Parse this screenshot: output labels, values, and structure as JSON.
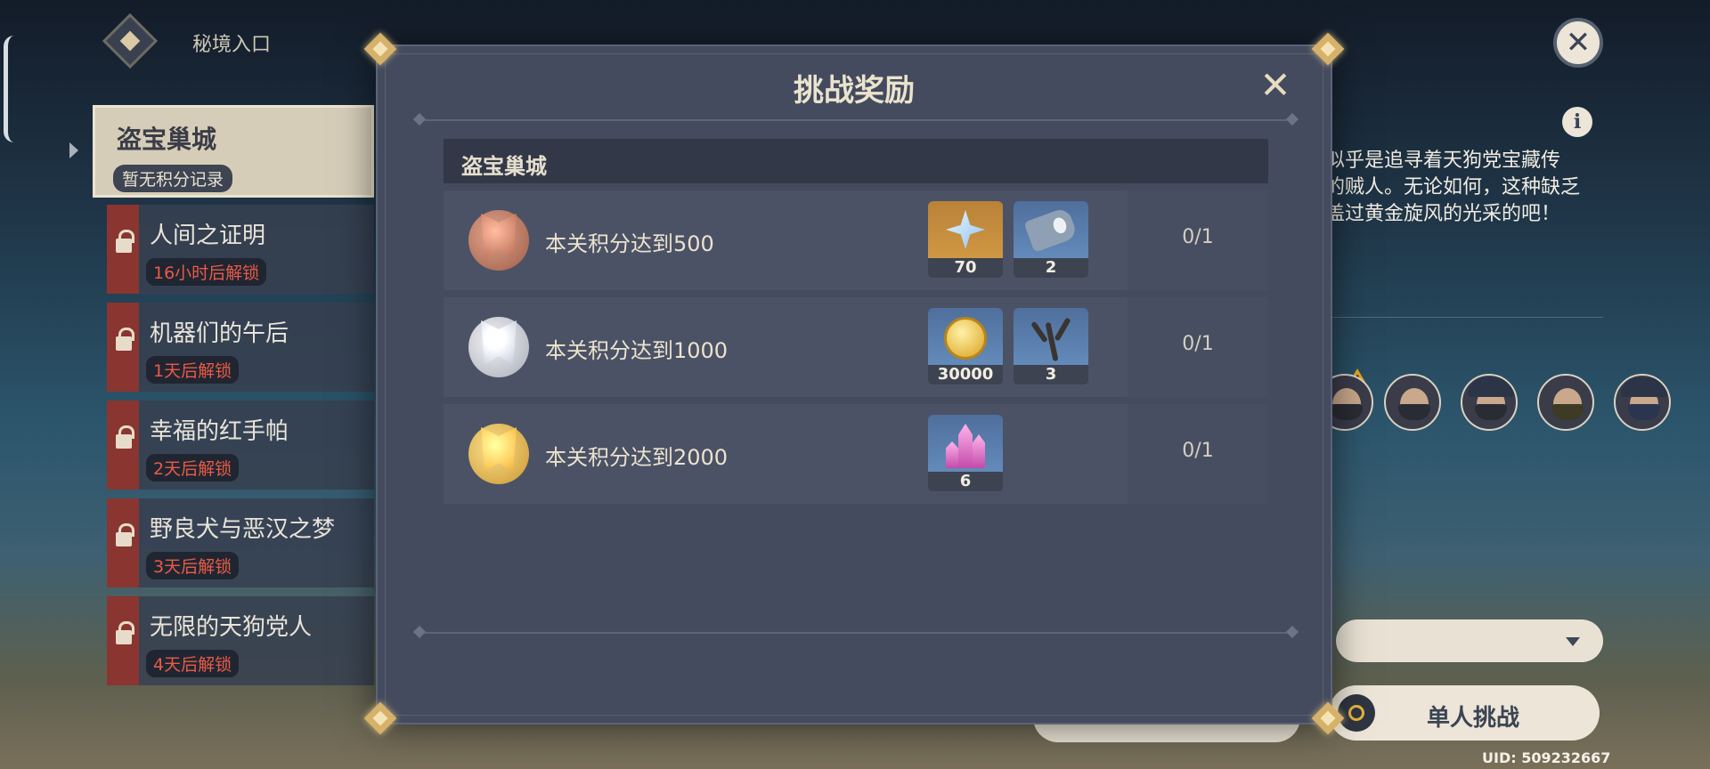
{
  "header": {
    "title": "秘境入口",
    "close_icon": "close-icon"
  },
  "domain_list": {
    "active": {
      "name": "盗宝巢城",
      "status": "暂无积分记录"
    },
    "items": [
      {
        "name": "人间之证明",
        "unlock": "16小时后解锁"
      },
      {
        "name": "机器们的午后",
        "unlock": "1天后解锁"
      },
      {
        "name": "幸福的红手帕",
        "unlock": "2天后解锁"
      },
      {
        "name": "野良犬与恶汉之梦",
        "unlock": "3天后解锁"
      },
      {
        "name": "无限的天狗党人",
        "unlock": "4天后解锁"
      }
    ]
  },
  "description": {
    "lines": [
      "似乎是追寻着天狗党宝藏传",
      "的贼人。无论如何，这种缺乏",
      "盖过黄金旋风的光采的吧！"
    ]
  },
  "buttons": {
    "solo": "单人挑战"
  },
  "uid": "UID: 509232667",
  "modal": {
    "title": "挑战奖励",
    "section": "盗宝巢城",
    "rows": [
      {
        "medal": "bronze",
        "condition": "本关积分达到500",
        "progress": "0/1",
        "rewards": [
          {
            "icon": "primogem-icon",
            "rarity": 5,
            "qty": "70"
          },
          {
            "icon": "hammer-icon",
            "rarity": 3,
            "qty": "2"
          }
        ]
      },
      {
        "medal": "silver",
        "condition": "本关积分达到1000",
        "progress": "0/1",
        "rewards": [
          {
            "icon": "mora-icon",
            "rarity": 3,
            "qty": "30000"
          },
          {
            "icon": "coral-branch-icon",
            "rarity": 3,
            "qty": "3"
          }
        ]
      },
      {
        "medal": "gold",
        "condition": "本关积分达到2000",
        "progress": "0/1",
        "rewards": [
          {
            "icon": "crystal-icon",
            "rarity": 3,
            "qty": "6"
          }
        ]
      }
    ]
  },
  "colors": {
    "accent_gold": "#d6b16a",
    "lock_red": "#8a3530",
    "unlock_text": "#ea5a47",
    "modal_bg": "#444b5e"
  }
}
